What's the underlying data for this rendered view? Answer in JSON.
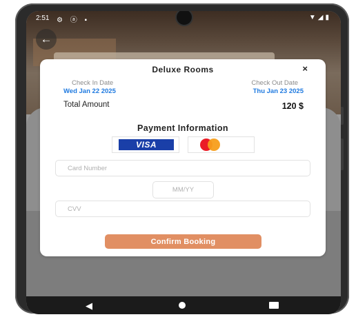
{
  "status_bar": {
    "time": "2:51",
    "left_icons": "⚙ ⓐ ▪",
    "right_icons": "▼◢▮"
  },
  "nav": {
    "back_arrow": "←"
  },
  "modal": {
    "title": "Deluxe Rooms",
    "close_glyph": "×",
    "check_in_label": "Check In Date",
    "check_in_value": "Wed Jan 22 2025",
    "check_out_label": "Check Out Date",
    "check_out_value": "Thu Jan 23 2025",
    "total_label": "Total Amount",
    "total_value": "120 $",
    "payment_title": "Payment Information",
    "visa_label": "VISA",
    "card_number_placeholder": "Card Number",
    "expiry_placeholder": "MM/YY",
    "cvv_placeholder": "CVV",
    "confirm_label": "Confirm Booking"
  },
  "system_nav": {
    "back": "◀"
  },
  "colors": {
    "accent_blue": "#1f7ae0",
    "confirm_button": "#e18f63",
    "visa_blue": "#1a3fa8",
    "mc_red": "#eb1c26",
    "mc_orange": "#f79e1b"
  }
}
